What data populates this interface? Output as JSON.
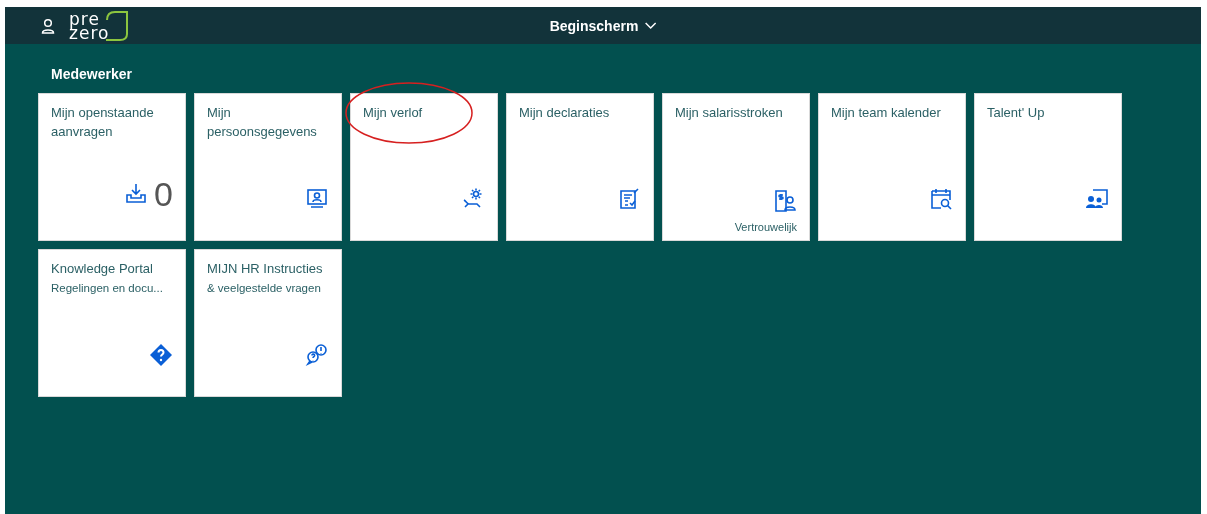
{
  "header": {
    "logo": {
      "line_1": "pre",
      "line_2": "zero"
    },
    "title": "Beginscherm"
  },
  "group": {
    "title": "Medewerker"
  },
  "tiles": [
    {
      "title": "Mijn openstaande aanvragen",
      "number": "0",
      "circled": false
    },
    {
      "title": "Mijn persoonsgegevens",
      "circled": false
    },
    {
      "title": "Mijn verlof",
      "circled": true
    },
    {
      "title": "Mijn declaraties",
      "circled": false
    },
    {
      "title": "Mijn salarisstroken",
      "footer": "Vertrouwelijk",
      "circled": false
    },
    {
      "title": "Mijn team kalender",
      "circled": false
    },
    {
      "title": "Talent' Up",
      "circled": false
    },
    {
      "title": "Knowledge Portal",
      "subtitle": "Regelingen en docu...",
      "circled": false
    },
    {
      "title": "MIJN HR Instructies",
      "subtitle": "& veelgestelde vragen",
      "circled": false
    }
  ]
}
